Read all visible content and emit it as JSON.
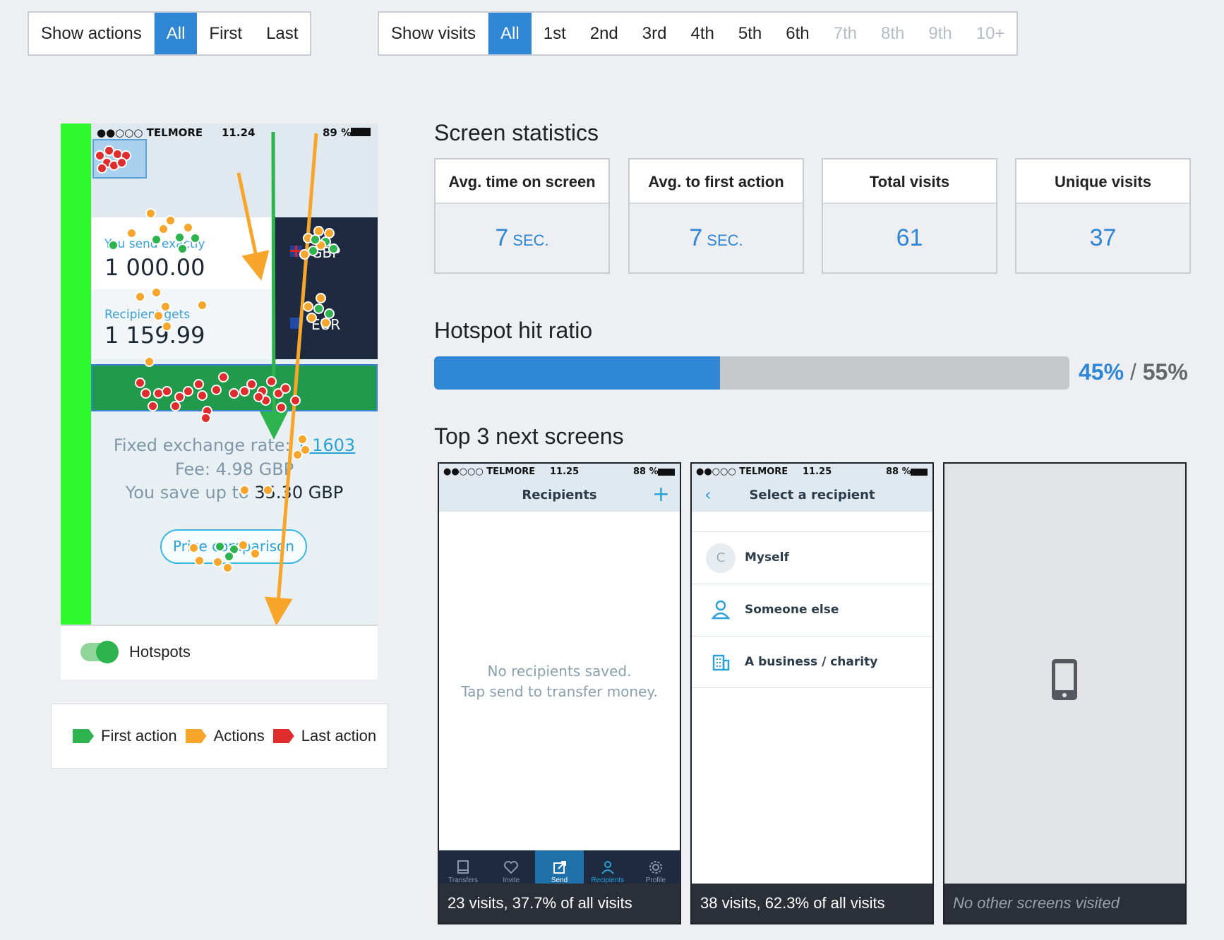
{
  "actions_filter": {
    "label": "Show actions",
    "options": [
      "All",
      "First",
      "Last"
    ],
    "selected": "All"
  },
  "visits_filter": {
    "label": "Show visits",
    "options": [
      "All",
      "1st",
      "2nd",
      "3rd",
      "4th",
      "5th",
      "6th",
      "7th",
      "8th",
      "9th",
      "10+"
    ],
    "selected": "All",
    "disabled": [
      "7th",
      "8th",
      "9th",
      "10+"
    ]
  },
  "heatmap": {
    "status_carrier": "●●○○○ TELMORE",
    "status_time": "11.24",
    "status_battery": "89 %",
    "send_label": "You send exactly",
    "send_value": "1 000.00",
    "receive_label": "Recipient gets",
    "receive_value": "1 159.99",
    "currency_1": "GBP",
    "currency_2": "EUR",
    "rate_label": "Fixed exchange rate:",
    "rate_value": "1.1603",
    "fee_text": "Fee: 4.98 GBP",
    "save_label": "You save up to",
    "save_value": "35.30 GBP",
    "price_button": "Price comparison",
    "toggle_label": "Hotspots",
    "toggle_on": true
  },
  "legend": {
    "first": "First action",
    "actions": "Actions",
    "last": "Last action",
    "colors": {
      "first": "#2db44e",
      "actions": "#f7a62b",
      "last": "#e02c2c"
    }
  },
  "stats": {
    "title": "Screen statistics",
    "cards": [
      {
        "label": "Avg. time on screen",
        "value": "7",
        "unit": "SEC."
      },
      {
        "label": "Avg. to first action",
        "value": "7",
        "unit": "SEC."
      },
      {
        "label": "Total visits",
        "value": "61",
        "unit": ""
      },
      {
        "label": "Unique visits",
        "value": "37",
        "unit": ""
      }
    ]
  },
  "hit_ratio": {
    "title": "Hotspot hit ratio",
    "hit_percent": 45,
    "hit_text": "45%",
    "separator": "/",
    "miss_text": "55%"
  },
  "next_screens": {
    "title": "Top 3 next screens",
    "cards": [
      {
        "status_carrier": "●●○○○ TELMORE",
        "status_time": "11.25",
        "status_battery": "88 %",
        "screen_title": "Recipients",
        "empty_line1": "No recipients saved.",
        "empty_line2": "Tap send to transfer money.",
        "tabs": [
          "Transfers",
          "Invite",
          "Send",
          "Recipients",
          "Profile"
        ],
        "caption": "23 visits, 37.7% of all visits"
      },
      {
        "status_carrier": "●●○○○ TELMORE",
        "status_time": "11.25",
        "status_battery": "88 %",
        "screen_title": "Select a recipient",
        "items": [
          {
            "initial": "C",
            "label": "Myself"
          },
          {
            "label": "Someone else"
          },
          {
            "label": "A business / charity"
          }
        ],
        "caption": "38 visits, 62.3% of all visits"
      },
      {
        "caption": "No other screens visited"
      }
    ]
  }
}
